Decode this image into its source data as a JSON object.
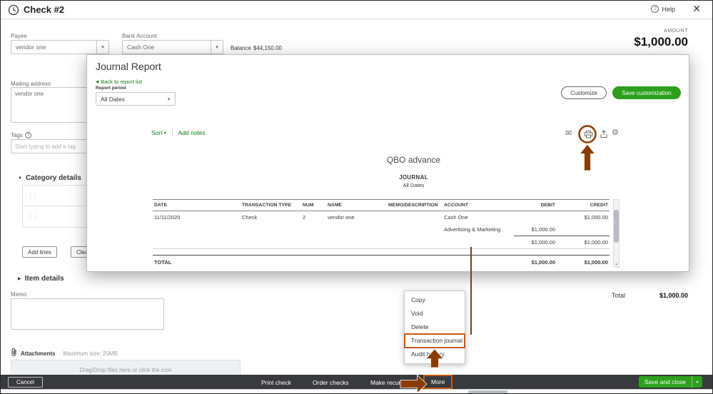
{
  "colors": {
    "accent_green": "#2ca01c",
    "link_green": "#0f7b0f",
    "annotation_box": "#c55a11",
    "annotation_arrow": "#8a3c00",
    "footer_bar": "#393a3d"
  },
  "icons": {
    "close": "✕",
    "help": "?",
    "chevron_down": "▾",
    "triangle_down": "▼",
    "triangle_right": "▶",
    "back": "◀",
    "drag_handle": "⋮⋮",
    "envelope": "✉",
    "gear": "⚙"
  },
  "header": {
    "title": "Check #2",
    "help_label": "Help"
  },
  "check_form": {
    "payee_label": "Payee",
    "payee_value": "vendor one",
    "bank_account_label": "Bank Account",
    "bank_account_value": "Cash One",
    "balance_label": "Balance",
    "balance_value": "$44,150.00",
    "amount_label": "AMOUNT",
    "amount_value": "$1,000.00",
    "mailing_address_label": "Mailing address",
    "mailing_address_value": "vendor one",
    "tags_label": "Tags",
    "tags_placeholder": "Start typing to add a tag",
    "category_details_label": "Category details",
    "add_lines_label": "Add lines",
    "clear_lines_label": "Clear all lines",
    "item_details_label": "Item details",
    "memo_label": "Memo",
    "attachments_label": "Attachments",
    "attachments_max_label": "Maximum size: 20MB",
    "dropzone_text": "Drag/Drop files here or click the icon",
    "total_label": "Total",
    "total_value": "$1,000.00"
  },
  "footer": {
    "cancel_label": "Cancel",
    "print_check_label": "Print check",
    "order_checks_label": "Order checks",
    "make_recurring_label": "Make recurring",
    "more_label": "More",
    "save_and_close_label": "Save and close"
  },
  "context_menu": {
    "items": [
      "Copy",
      "Void",
      "Delete",
      "Transaction journal",
      "Audit history"
    ]
  },
  "journal_report": {
    "title": "Journal Report",
    "back_link": "Back to report list",
    "report_period_label": "Report period",
    "period_value": "All Dates",
    "customize_label": "Customize",
    "save_customization_label": "Save customization",
    "sort_label": "Sort",
    "add_notes_label": "Add notes",
    "company_name": "QBO advance",
    "report_title": "JOURNAL",
    "report_period": "All Dates",
    "table": {
      "headers": [
        "DATE",
        "TRANSACTION TYPE",
        "NUM",
        "NAME",
        "MEMO/DESCRIPTION",
        "ACCOUNT",
        "DEBIT",
        "CREDIT"
      ],
      "line1": {
        "date": "11/11/2020",
        "type": "Check",
        "num": "2",
        "name": "vendor one",
        "memo": "",
        "account": "Cash One",
        "debit": "",
        "credit": "$1,000.00"
      },
      "line2": {
        "account": "Advertising & Marketing",
        "debit": "$1,000.00",
        "credit": ""
      },
      "subtotal": {
        "debit": "$1,000.00",
        "credit": "$1,000.00"
      },
      "total_label": "TOTAL",
      "total_debit": "$1,000.00",
      "total_credit": "$1,000.00"
    }
  }
}
